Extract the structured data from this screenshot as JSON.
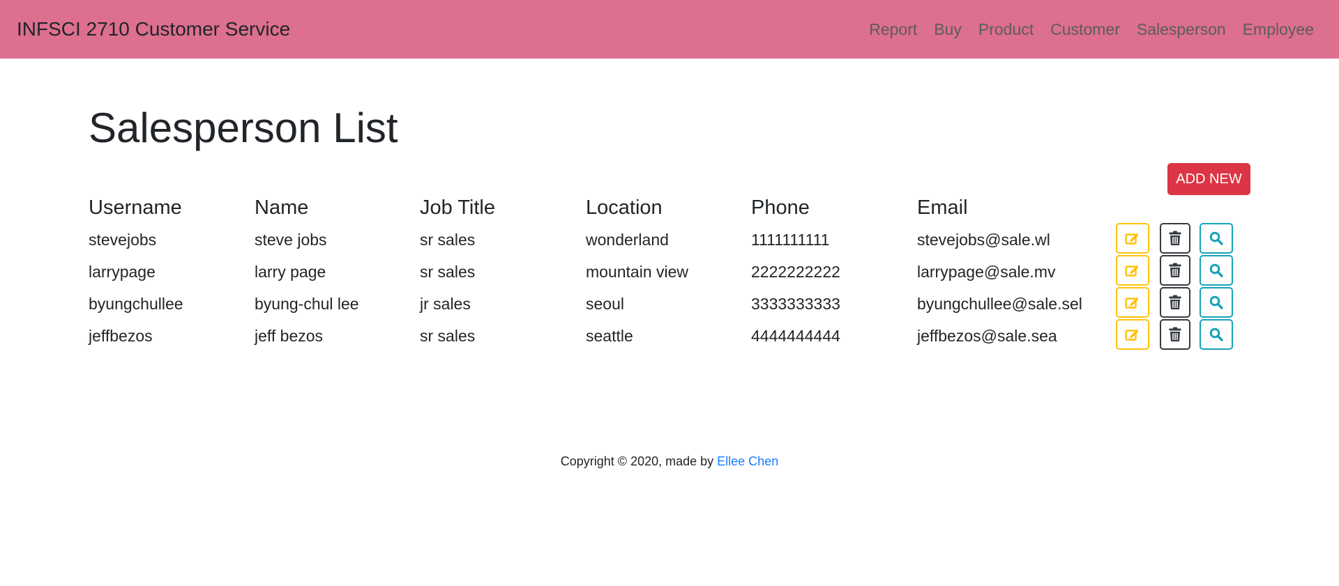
{
  "navbar": {
    "brand": "INFSCI 2710 Customer Service",
    "links": [
      "Report",
      "Buy",
      "Product",
      "Customer",
      "Salesperson",
      "Employee"
    ]
  },
  "page": {
    "title": "Salesperson List",
    "add_new_label": "ADD NEW"
  },
  "table": {
    "headers": [
      "Username",
      "Name",
      "Job Title",
      "Location",
      "Phone",
      "Email"
    ],
    "rows": [
      [
        "stevejobs",
        "steve jobs",
        "sr sales",
        "wonderland",
        "1111111111",
        "stevejobs@sale.wl"
      ],
      [
        "larrypage",
        "larry page",
        "sr sales",
        "mountain view",
        "2222222222",
        "larrypage@sale.mv"
      ],
      [
        "byungchullee",
        "byung-chul lee",
        "jr sales",
        "seoul",
        "3333333333",
        "byungchullee@sale.sel"
      ],
      [
        "jeffbezos",
        "jeff bezos",
        "sr sales",
        "seattle",
        "4444444444",
        "jeffbezos@sale.sea"
      ]
    ],
    "row_actions": [
      "edit-icon",
      "trash-icon",
      "search-icon"
    ]
  },
  "footer": {
    "text": "Copyright © 2020, made by ",
    "author": "Ellee Chen"
  },
  "colors": {
    "navbar": "#dd6f8f",
    "danger": "#dc3545",
    "warning": "#ffc107",
    "dark": "#343a40",
    "info": "#17a2b8",
    "link": "#1a7cff"
  }
}
